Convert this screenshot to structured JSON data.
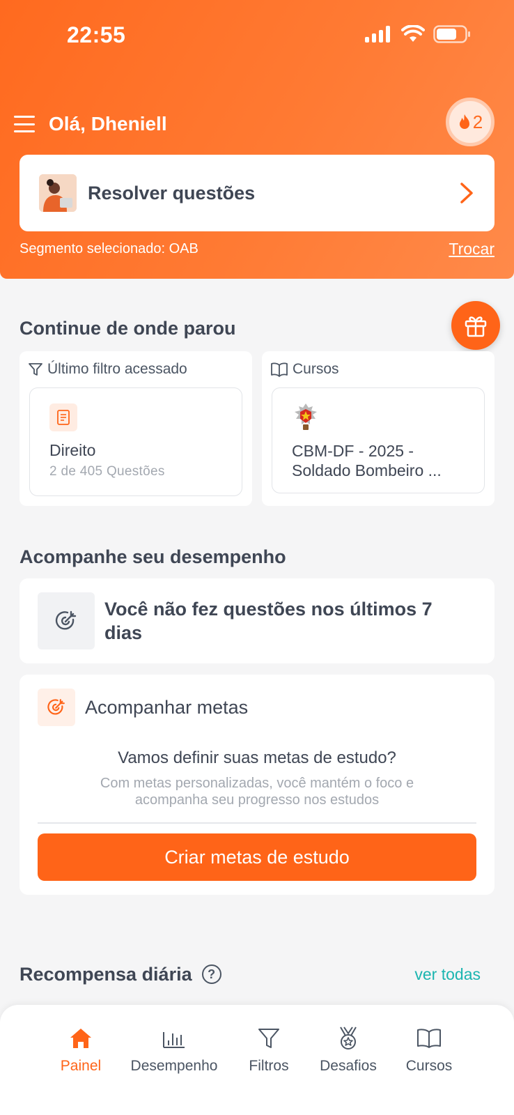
{
  "status_bar": {
    "time": "22:55"
  },
  "header": {
    "greeting": "Olá, Dheniell",
    "streak_count": "2",
    "solve_card": {
      "label": "Resolver questões"
    },
    "segment_text": "Segmento selecionado: OAB",
    "swap_link": "Trocar"
  },
  "continue": {
    "title": "Continue de onde parou",
    "last_filter": {
      "heading": "Último filtro acessado",
      "item_title": "Direito",
      "item_sub": "2 de 405 Questões"
    },
    "courses": {
      "heading": "Cursos",
      "item_title_line1": "CBM-DF - 2025 -",
      "item_title_line2": "Soldado Bombeiro ..."
    }
  },
  "performance": {
    "title": "Acompanhe seu desempenho",
    "empty_line1": "Você não fez questões nos últimos 7",
    "empty_line2": "dias",
    "goals": {
      "title": "Acompanhar metas",
      "question": "Vamos definir suas metas de estudo?",
      "desc_line1": "Com metas personalizadas, você mantém o foco e",
      "desc_line2": "acompanha seu progresso nos estudos",
      "button": "Criar metas de estudo"
    }
  },
  "rewards": {
    "title": "Recompensa diária",
    "help": "?",
    "see_all": "ver todas"
  },
  "nav": {
    "items": [
      {
        "label": "Painel",
        "icon": "home-icon",
        "active": true
      },
      {
        "label": "Desempenho",
        "icon": "bar-chart-icon",
        "active": false
      },
      {
        "label": "Filtros",
        "icon": "filter-icon",
        "active": false
      },
      {
        "label": "Desafios",
        "icon": "medal-icon",
        "active": false
      },
      {
        "label": "Cursos",
        "icon": "book-icon",
        "active": false
      }
    ]
  },
  "colors": {
    "brand": "#ff6418",
    "accent_link": "#1bb5b0",
    "text": "#3f4654"
  }
}
